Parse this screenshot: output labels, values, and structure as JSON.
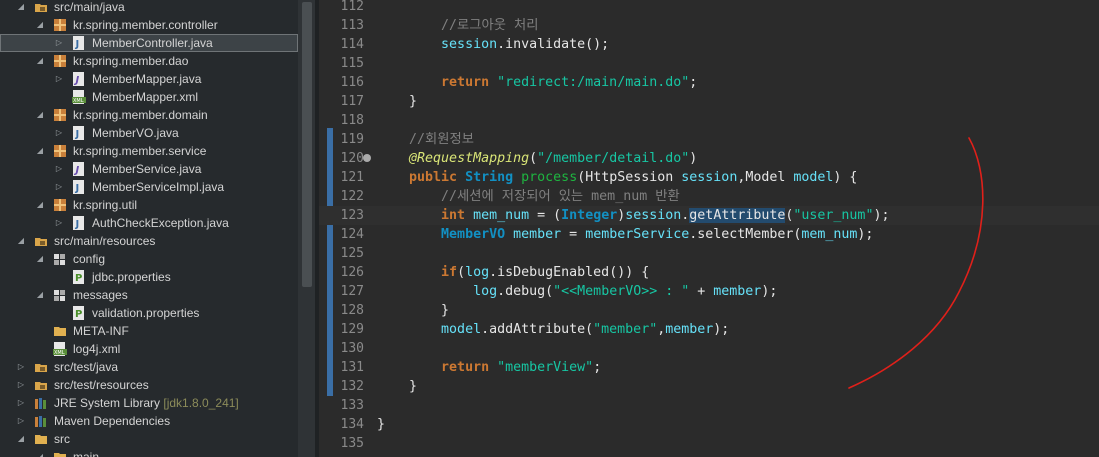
{
  "explorer": {
    "items": [
      {
        "label": "src/main/java",
        "decor": "",
        "icon": "source-folder-icon",
        "twisty": "◢",
        "indent": 1,
        "selected": false
      },
      {
        "label": "kr.spring.member.controller",
        "decor": "",
        "icon": "package-icon",
        "twisty": "◢",
        "indent": 2,
        "selected": false
      },
      {
        "label": "MemberController.java",
        "decor": "",
        "icon": "java-file-icon",
        "twisty": "▷",
        "indent": 3,
        "selected": true
      },
      {
        "label": "kr.spring.member.dao",
        "decor": "",
        "icon": "package-icon",
        "twisty": "◢",
        "indent": 2,
        "selected": false
      },
      {
        "label": "MemberMapper.java",
        "decor": "",
        "icon": "java-interface-icon",
        "twisty": "▷",
        "indent": 3,
        "selected": false
      },
      {
        "label": "MemberMapper.xml",
        "decor": "",
        "icon": "xml-file-icon",
        "twisty": "",
        "indent": 3,
        "selected": false
      },
      {
        "label": "kr.spring.member.domain",
        "decor": "",
        "icon": "package-icon",
        "twisty": "◢",
        "indent": 2,
        "selected": false
      },
      {
        "label": "MemberVO.java",
        "decor": "",
        "icon": "java-file-icon",
        "twisty": "▷",
        "indent": 3,
        "selected": false
      },
      {
        "label": "kr.spring.member.service",
        "decor": "",
        "icon": "package-icon",
        "twisty": "◢",
        "indent": 2,
        "selected": false
      },
      {
        "label": "MemberService.java",
        "decor": "",
        "icon": "java-interface-icon",
        "twisty": "▷",
        "indent": 3,
        "selected": false
      },
      {
        "label": "MemberServiceImpl.java",
        "decor": "",
        "icon": "java-file-icon",
        "twisty": "▷",
        "indent": 3,
        "selected": false
      },
      {
        "label": "kr.spring.util",
        "decor": "",
        "icon": "package-icon",
        "twisty": "◢",
        "indent": 2,
        "selected": false
      },
      {
        "label": "AuthCheckException.java",
        "decor": "",
        "icon": "java-file-icon",
        "twisty": "▷",
        "indent": 3,
        "selected": false
      },
      {
        "label": "src/main/resources",
        "decor": "",
        "icon": "source-folder-icon",
        "twisty": "◢",
        "indent": 1,
        "selected": false
      },
      {
        "label": "config",
        "decor": "",
        "icon": "folder-package-icon",
        "twisty": "◢",
        "indent": 2,
        "selected": false
      },
      {
        "label": "jdbc.properties",
        "decor": "",
        "icon": "properties-file-icon",
        "twisty": "",
        "indent": 3,
        "selected": false
      },
      {
        "label": "messages",
        "decor": "",
        "icon": "folder-package-icon",
        "twisty": "◢",
        "indent": 2,
        "selected": false
      },
      {
        "label": "validation.properties",
        "decor": "",
        "icon": "properties-file-icon",
        "twisty": "",
        "indent": 3,
        "selected": false
      },
      {
        "label": "META-INF",
        "decor": "",
        "icon": "folder-icon",
        "twisty": "",
        "indent": 2,
        "selected": false
      },
      {
        "label": "log4j.xml",
        "decor": "",
        "icon": "xml-file-icon",
        "twisty": "",
        "indent": 2,
        "selected": false
      },
      {
        "label": "src/test/java",
        "decor": "",
        "icon": "source-folder-icon",
        "twisty": "▷",
        "indent": 1,
        "selected": false
      },
      {
        "label": "src/test/resources",
        "decor": "",
        "icon": "source-folder-icon",
        "twisty": "▷",
        "indent": 1,
        "selected": false
      },
      {
        "label": "JRE System Library",
        "decor": "[jdk1.8.0_241]",
        "icon": "library-icon",
        "twisty": "▷",
        "indent": 1,
        "selected": false
      },
      {
        "label": "Maven Dependencies",
        "decor": "",
        "icon": "library-icon",
        "twisty": "▷",
        "indent": 1,
        "selected": false
      },
      {
        "label": "src",
        "decor": "",
        "icon": "folder-icon",
        "twisty": "◢",
        "indent": 1,
        "selected": false
      },
      {
        "label": "main",
        "decor": "",
        "icon": "folder-icon",
        "twisty": "◢",
        "indent": 2,
        "selected": false
      }
    ]
  },
  "editor": {
    "lines": [
      {
        "num": "112",
        "segs": []
      },
      {
        "num": "113",
        "segs": [
          [
            "        ",
            ""
          ],
          [
            "//로그아웃 처리",
            "c"
          ]
        ]
      },
      {
        "num": "114",
        "segs": [
          [
            "        ",
            ""
          ],
          [
            "session",
            "v"
          ],
          [
            ".invalidate();",
            ""
          ]
        ]
      },
      {
        "num": "115",
        "segs": []
      },
      {
        "num": "116",
        "segs": [
          [
            "        ",
            ""
          ],
          [
            "return",
            "k"
          ],
          [
            " ",
            ""
          ],
          [
            "\"redirect:/main/main.do\"",
            "s"
          ],
          [
            ";",
            ""
          ]
        ]
      },
      {
        "num": "117",
        "segs": [
          [
            "    }",
            ""
          ]
        ]
      },
      {
        "num": "118",
        "segs": []
      },
      {
        "num": "119",
        "segs": [
          [
            "    ",
            ""
          ],
          [
            "//회원정보",
            "c"
          ]
        ]
      },
      {
        "num": "120",
        "segs": [
          [
            "    ",
            ""
          ],
          [
            "@RequestMapping",
            "ann"
          ],
          [
            "(",
            ""
          ],
          [
            "\"/member/detail.do\"",
            "s"
          ],
          [
            ")",
            ""
          ]
        ]
      },
      {
        "num": "121",
        "segs": [
          [
            "    ",
            ""
          ],
          [
            "public",
            "k"
          ],
          [
            " ",
            ""
          ],
          [
            "String",
            "t"
          ],
          [
            " ",
            ""
          ],
          [
            "process",
            "m"
          ],
          [
            "(HttpSession ",
            ""
          ],
          [
            "session",
            "v"
          ],
          [
            ",Model ",
            ""
          ],
          [
            "model",
            "v"
          ],
          [
            ") {",
            ""
          ]
        ]
      },
      {
        "num": "122",
        "segs": [
          [
            "        ",
            ""
          ],
          [
            "//세션에 저장되어 있는 mem_num 반환",
            "c"
          ]
        ]
      },
      {
        "num": "123",
        "segs": [
          [
            "        ",
            ""
          ],
          [
            "int",
            "k"
          ],
          [
            " ",
            ""
          ],
          [
            "mem_num",
            "v"
          ],
          [
            " = (",
            ""
          ],
          [
            "Integer",
            "t"
          ],
          [
            ")",
            ""
          ],
          [
            "session",
            "v"
          ],
          [
            ".",
            ""
          ],
          [
            "getAttribute",
            "hl"
          ],
          [
            "(",
            ""
          ],
          [
            "\"user_num\"",
            "s"
          ],
          [
            ");",
            ""
          ]
        ]
      },
      {
        "num": "124",
        "segs": [
          [
            "        ",
            ""
          ],
          [
            "MemberVO",
            "t"
          ],
          [
            " ",
            ""
          ],
          [
            "member",
            "v"
          ],
          [
            " = ",
            ""
          ],
          [
            "memberService",
            "v"
          ],
          [
            ".selectMember(",
            ""
          ],
          [
            "mem_num",
            "v"
          ],
          [
            ");",
            ""
          ]
        ]
      },
      {
        "num": "125",
        "segs": []
      },
      {
        "num": "126",
        "segs": [
          [
            "        ",
            ""
          ],
          [
            "if",
            "k"
          ],
          [
            "(",
            ""
          ],
          [
            "log",
            "v"
          ],
          [
            ".isDebugEnabled()) {",
            ""
          ]
        ]
      },
      {
        "num": "127",
        "segs": [
          [
            "            ",
            ""
          ],
          [
            "log",
            "v"
          ],
          [
            ".debug(",
            ""
          ],
          [
            "\"<<MemberVO>> : \"",
            "s"
          ],
          [
            " + ",
            ""
          ],
          [
            "member",
            "v"
          ],
          [
            ");",
            ""
          ]
        ]
      },
      {
        "num": "128",
        "segs": [
          [
            "        }",
            ""
          ]
        ]
      },
      {
        "num": "129",
        "segs": [
          [
            "        ",
            ""
          ],
          [
            "model",
            "v"
          ],
          [
            ".addAttribute(",
            ""
          ],
          [
            "\"member\"",
            "s"
          ],
          [
            ",",
            ""
          ],
          [
            "member",
            "v"
          ],
          [
            ");",
            ""
          ]
        ]
      },
      {
        "num": "130",
        "segs": []
      },
      {
        "num": "131",
        "segs": [
          [
            "        ",
            ""
          ],
          [
            "return",
            "k"
          ],
          [
            " ",
            ""
          ],
          [
            "\"memberView\"",
            "s"
          ],
          [
            ";",
            ""
          ]
        ]
      },
      {
        "num": "132",
        "segs": [
          [
            "    }",
            ""
          ]
        ]
      },
      {
        "num": "133",
        "segs": []
      },
      {
        "num": "134",
        "segs": [
          [
            "}",
            ""
          ]
        ]
      },
      {
        "num": "135",
        "segs": []
      }
    ]
  },
  "annotation": {
    "color": "#e0201a",
    "shape": "freehand-red-arc"
  }
}
